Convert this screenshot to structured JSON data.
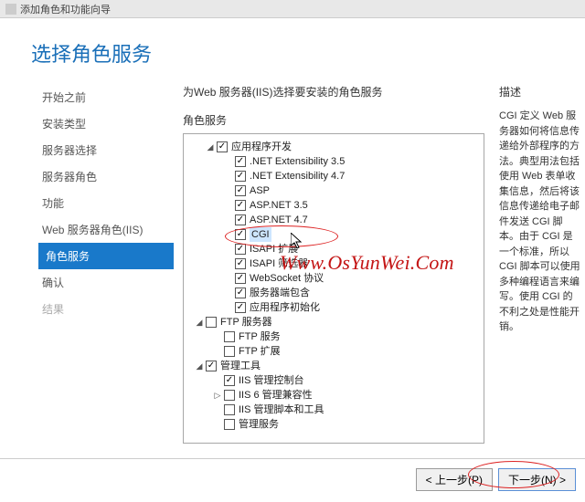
{
  "window": {
    "title": "添加角色和功能向导"
  },
  "heading": "选择角色服务",
  "sidebar": {
    "items": [
      {
        "label": "开始之前"
      },
      {
        "label": "安装类型"
      },
      {
        "label": "服务器选择"
      },
      {
        "label": "服务器角色"
      },
      {
        "label": "功能"
      },
      {
        "label": "Web 服务器角色(IIS)"
      },
      {
        "label": "角色服务"
      },
      {
        "label": "确认"
      },
      {
        "label": "结果"
      }
    ]
  },
  "instruction": "为Web 服务器(IIS)选择要安装的角色服务",
  "sections": {
    "roles": "角色服务",
    "desc": "描述"
  },
  "tree": {
    "app_dev": "应用程序开发",
    "net_ext_35": ".NET Extensibility 3.5",
    "net_ext_47": ".NET Extensibility 4.7",
    "asp": "ASP",
    "aspnet_35": "ASP.NET 3.5",
    "aspnet_47": "ASP.NET 4.7",
    "cgi": "CGI",
    "isapi_ext": "ISAPI 扩展",
    "isapi_filt": "ISAPI 筛选器",
    "websocket": "WebSocket 协议",
    "ssi": "服务器端包含",
    "app_init": "应用程序初始化",
    "ftp_server": "FTP 服务器",
    "ftp_svc": "FTP 服务",
    "ftp_ext": "FTP 扩展",
    "mgmt_tools": "管理工具",
    "iis_console": "IIS 管理控制台",
    "iis6_compat": "IIS 6 管理兼容性",
    "iis_scripts": "IIS 管理脚本和工具",
    "mgmt_svc": "管理服务"
  },
  "desc_body": "CGI 定义 Web 服务器如何将信息传递给外部程序的方法。典型用法包括使用 Web 表单收集信息，然后将该信息传递给电子邮件发送 CGI 脚本。由于 CGI 是一个标准，所以 CGI 脚本可以使用多种编程语言来编写。使用 CGI 的不利之处是性能开销。",
  "buttons": {
    "prev": "< 上一步(P)",
    "next": "下一步(N) >"
  },
  "watermark": "Www.OsYunWei.Com"
}
